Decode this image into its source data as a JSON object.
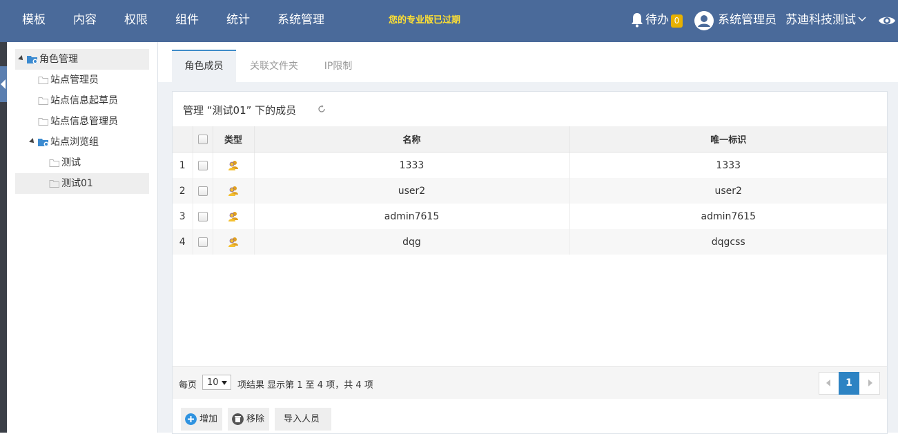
{
  "topnav": {
    "items": [
      "模板",
      "内容",
      "权限",
      "组件",
      "统计",
      "系统管理"
    ],
    "expired_notice": "您的专业版已过期",
    "todo_label": "待办",
    "todo_count": "0",
    "user_name": "系统管理员",
    "org_name": "苏迪科技测试",
    "colors": {
      "bar": "#4a6a9a",
      "notice": "#ffe033",
      "badge": "#e8b100"
    }
  },
  "tree": {
    "root": "角色管理",
    "items": [
      "站点管理员",
      "站点信息起草员",
      "站点信息管理员"
    ],
    "group": "站点浏览组",
    "children": [
      "测试",
      "测试01"
    ],
    "selected": "测试01"
  },
  "tabs": [
    "角色成员",
    "关联文件夹",
    "IP限制"
  ],
  "panel": {
    "title": "管理 “测试01” 下的成员",
    "columns": [
      "类型",
      "名称",
      "唯一标识"
    ],
    "rows": [
      {
        "idx": "1",
        "name": "1333",
        "uid": "1333"
      },
      {
        "idx": "2",
        "name": "user2",
        "uid": "user2"
      },
      {
        "idx": "3",
        "name": "admin7615",
        "uid": "admin7615"
      },
      {
        "idx": "4",
        "name": "dqg",
        "uid": "dqgcss"
      }
    ]
  },
  "footer": {
    "per_page_label": "每页",
    "per_page_value": "10",
    "info": "项结果  显示第 1 至 4 项，共 4 项",
    "current_page": "1"
  },
  "actions": {
    "add": "增加",
    "remove": "移除",
    "import": "导入人员"
  },
  "icons": [
    "bell-icon",
    "user-avatar-icon",
    "chevron-down-icon",
    "eye-icon",
    "folder-icon",
    "role-folder-icon",
    "refresh-icon",
    "people-icon",
    "plus-circle-icon",
    "trash-icon"
  ]
}
